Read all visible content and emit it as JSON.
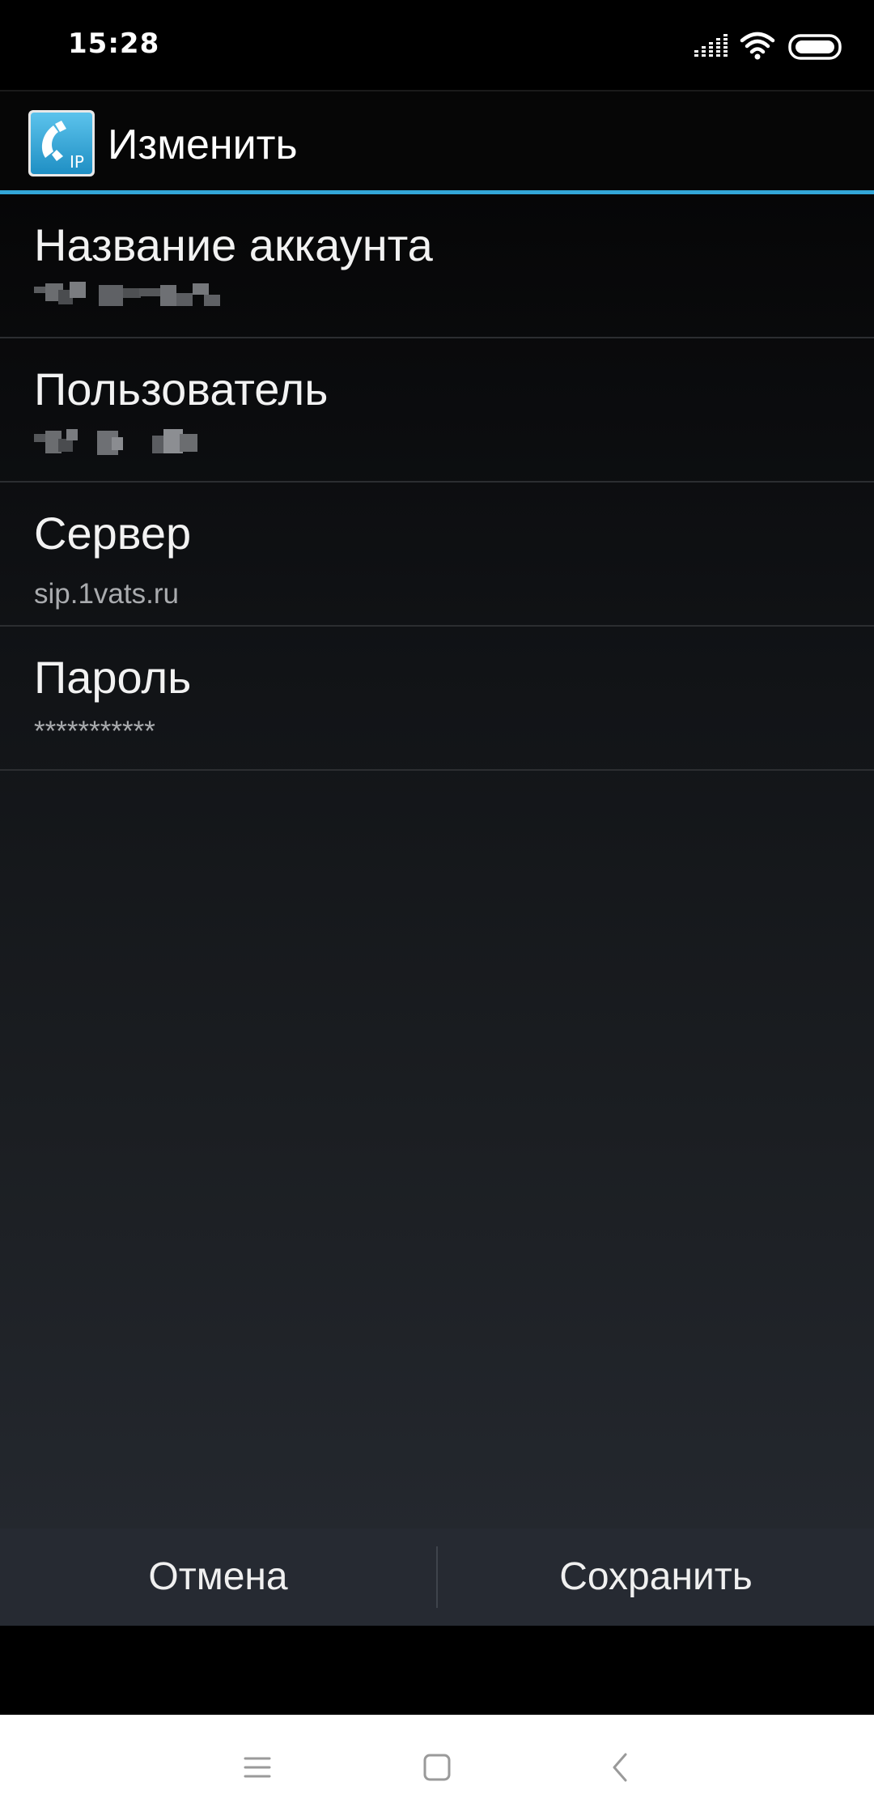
{
  "status_bar": {
    "time": "15:28",
    "icons": [
      "signal-icon",
      "wifi-icon",
      "battery-icon"
    ]
  },
  "action_bar": {
    "app_icon": "sip-phone-app-icon",
    "app_icon_text": "IP",
    "title": "Изменить"
  },
  "preferences": [
    {
      "title": "Название аккаунта",
      "summary": "",
      "summary_obscured": true
    },
    {
      "title": "Пользователь",
      "summary": "",
      "summary_obscured": true
    },
    {
      "title": "Сервер",
      "summary": "sip.1vats.ru",
      "summary_obscured": false
    },
    {
      "title": "Пароль",
      "summary": "***********",
      "summary_obscured": false
    }
  ],
  "buttons": {
    "cancel": "Отмена",
    "save": "Сохранить"
  },
  "nav_bar": {
    "icons": [
      "menu-icon",
      "home-icon",
      "back-icon"
    ]
  },
  "colors": {
    "accent": "#33a6d8",
    "background": "#000000",
    "text_primary": "#f2f2f2",
    "text_secondary": "#a9abae"
  }
}
